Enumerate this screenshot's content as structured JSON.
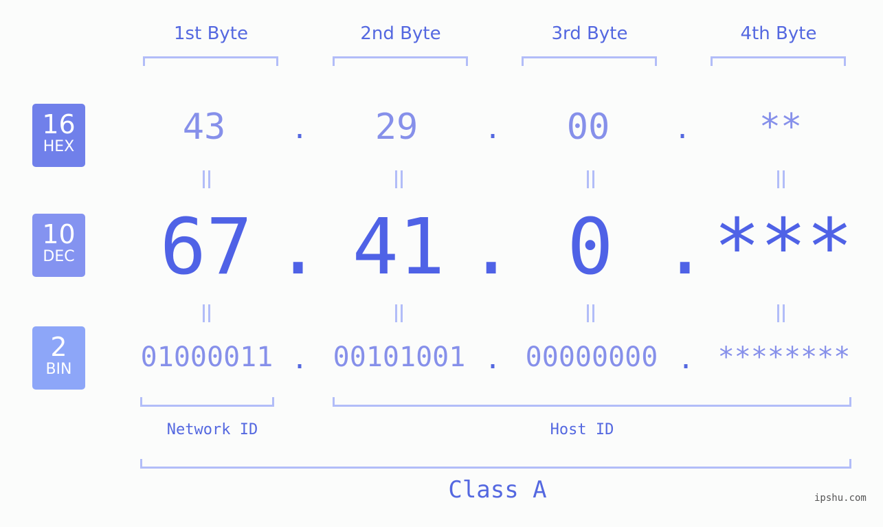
{
  "badges": [
    {
      "num": "16",
      "label": "HEX",
      "color": "#7080ea"
    },
    {
      "num": "10",
      "label": "DEC",
      "color": "#8493f0"
    },
    {
      "num": "2",
      "label": "BIN",
      "color": "#8da6f8"
    }
  ],
  "byte_headers": [
    "1st Byte",
    "2nd Byte",
    "3rd Byte",
    "4th Byte"
  ],
  "hex": [
    "43",
    "29",
    "00",
    "**"
  ],
  "dec": [
    "67",
    "41",
    "0",
    "***"
  ],
  "bin": [
    "01000011",
    "00101001",
    "00000000",
    "********"
  ],
  "separator": ".",
  "network_label": "Network ID",
  "host_label": "Host ID",
  "class_label": "Class A",
  "watermark": "ipshu.com"
}
